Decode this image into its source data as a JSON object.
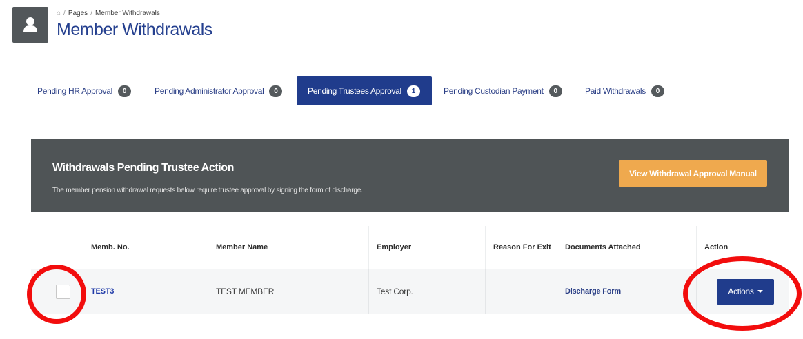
{
  "breadcrumb": {
    "home_icon": "home-icon",
    "items": [
      "Pages",
      "Member Withdrawals"
    ]
  },
  "page_title": "Member Withdrawals",
  "tabs": [
    {
      "label": "Pending HR Approval",
      "count": "0"
    },
    {
      "label": "Pending Administrator Approval",
      "count": "0"
    },
    {
      "label": "Pending Trustees Approval",
      "count": "1",
      "active": true
    },
    {
      "label": "Pending Custodian Payment",
      "count": "0"
    },
    {
      "label": "Paid Withdrawals",
      "count": "0"
    }
  ],
  "banner": {
    "title": "Withdrawals Pending Trustee Action",
    "subtitle": "The member pension withdrawal requests below require trustee approval by signing the form of discharge.",
    "manual_button": "View Withdrawal Approval Manual"
  },
  "table": {
    "columns": [
      "Memb. No.",
      "Member Name",
      "Employer",
      "Reason For Exit",
      "Documents Attached",
      "Action"
    ],
    "rows": [
      {
        "memb_no": "TEST3",
        "member_name": "TEST MEMBER",
        "employer": "Test Corp.",
        "reason": "",
        "documents": "Discharge Form",
        "action": "Actions"
      }
    ]
  },
  "colors": {
    "brand": "#203c8c",
    "banner": "#4f5456",
    "manual_button": "#efa94e",
    "annotation": "#f20d0d"
  }
}
